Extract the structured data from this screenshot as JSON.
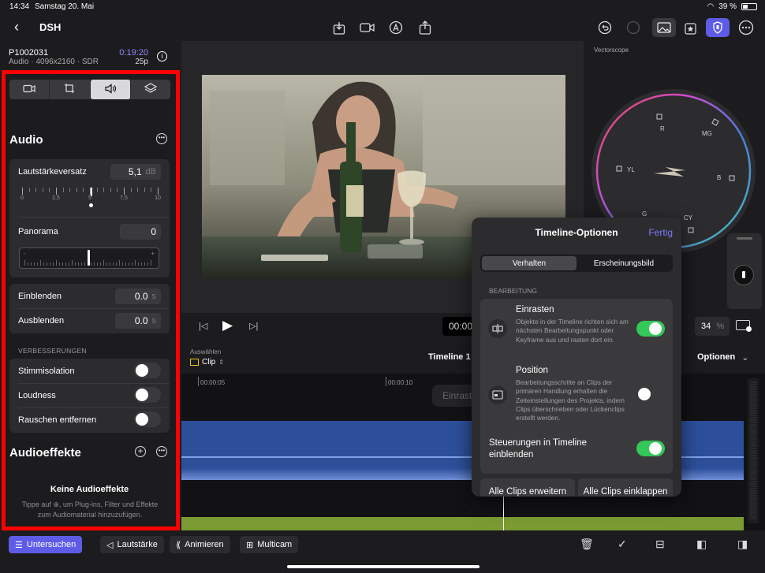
{
  "status": {
    "time": "14:34",
    "date": "Samstag 20. Mai",
    "battery": "39 %"
  },
  "toolbar": {
    "back": "‹",
    "title": "DSH"
  },
  "clip": {
    "name": "P1002031",
    "meta": "Audio · 4096x2160 · SDR",
    "timecode": "0:19:20",
    "fps": "25p"
  },
  "inspector": {
    "tabs": [
      {
        "icon": "video-camera-icon",
        "glyph": "▭"
      },
      {
        "icon": "crop-icon",
        "glyph": "⌗"
      },
      {
        "icon": "speaker-icon",
        "glyph": "🔈"
      },
      {
        "icon": "layers-icon",
        "glyph": "≋"
      }
    ],
    "audio_title": "Audio",
    "volume": {
      "label": "Lautstärkeversatz",
      "value": "5,1",
      "unit": "dB",
      "ticks": [
        "0",
        "2,5",
        "5",
        "7,5",
        "10"
      ]
    },
    "panorama": {
      "label": "Panorama",
      "value": "0",
      "minus": "-",
      "plus": "+"
    },
    "fade_in": {
      "label": "Einblenden",
      "value": "0.0",
      "unit": "s"
    },
    "fade_out": {
      "label": "Ausblenden",
      "value": "0.0",
      "unit": "s"
    },
    "enhancements_caption": "VERBESSERUNGEN",
    "enhancements": [
      {
        "label": "Stimmisolation",
        "on": false
      },
      {
        "label": "Loudness",
        "on": false
      },
      {
        "label": "Rauschen entfernen",
        "on": false
      }
    ],
    "effects_title": "Audioeffekte",
    "no_effects_title": "Keine Audioeffekte",
    "no_effects_desc": "Tippe auf ⊕, um Plug-ins, Filter und Effekte zum Audiomaterial hinzuzufügen."
  },
  "scope": {
    "title": "Vectorscope",
    "labels": [
      "R",
      "MG",
      "YL",
      "B",
      "G",
      "CY"
    ]
  },
  "transport": {
    "timecode": "00:00",
    "zoom": "34",
    "zoom_unit": "%"
  },
  "timeline": {
    "select_caption": "Auswählen",
    "select_value": "Clip",
    "title": "Timeline 1",
    "options": "Optionen",
    "ruler": [
      "00:00:05",
      "00:00:10"
    ],
    "snap_hint": "Einrast"
  },
  "popover": {
    "title": "Timeline-Optionen",
    "done": "Fertig",
    "segments": [
      "Verhalten",
      "Erscheinungsbild"
    ],
    "caption": "BEARBEITUNG",
    "snap": {
      "title": "Einrasten",
      "desc": "Objekte in der Timeline richten sich am nächsten Bearbeitungspunkt oder Keyframe aus und rasten dort ein.",
      "on": true
    },
    "position": {
      "title": "Position",
      "desc": "Bearbeitungsschritte an Clips der primären Handlung erhalten die Zeiteinstellungen des Projekts, indem Clips überschrieben oder Lückenclips erstellt werden.",
      "on": false
    },
    "controls": {
      "title": "Steuerungen in Timeline einblenden",
      "on": true
    },
    "expand_all": "Alle Clips erweitern",
    "collapse_all": "Alle Clips einklappen"
  },
  "bottom": {
    "inspect": "Untersuchen",
    "volume": "Lautstärke",
    "animate": "Animieren",
    "multicam": "Multicam"
  },
  "colors": {
    "accent": "#5e5ce6",
    "toggle_on": "#34c759",
    "highlight": "#ff0000",
    "timecode": "#8e8cff"
  }
}
